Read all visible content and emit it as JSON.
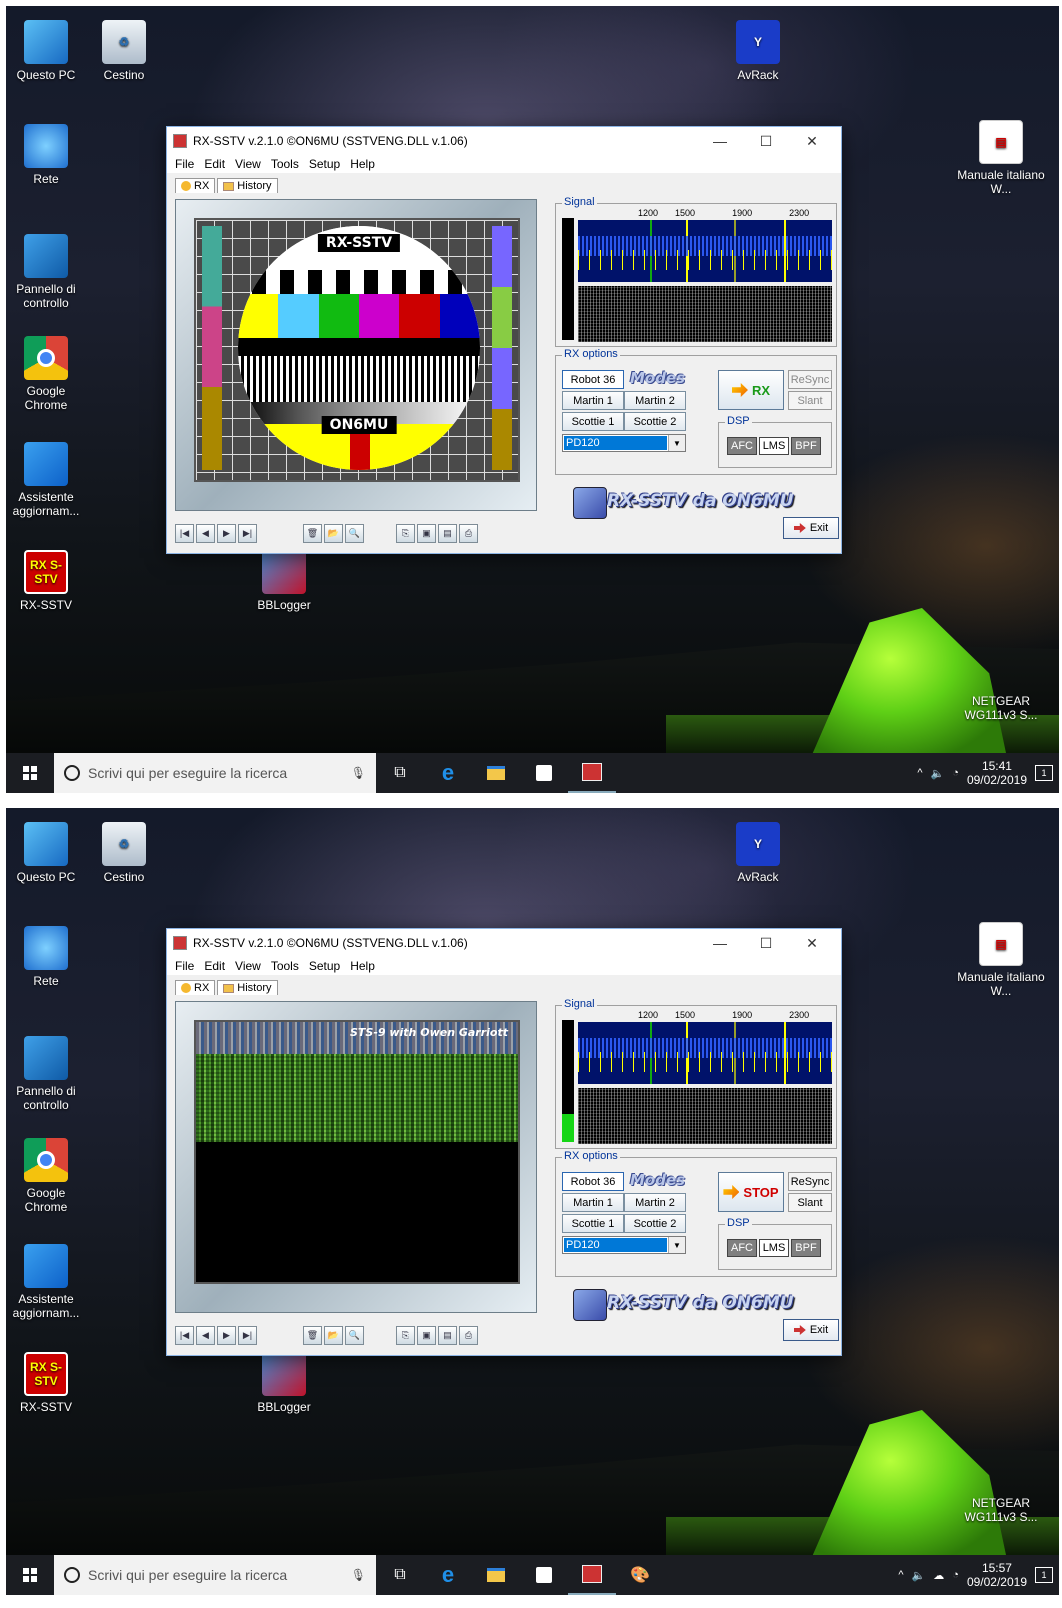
{
  "desktop": {
    "icons_left": [
      {
        "label": "Questo PC",
        "icon": "computer-icon"
      },
      {
        "label": "Cestino",
        "icon": "recycle-bin-icon"
      },
      {
        "label": "Rete",
        "icon": "network-icon"
      },
      {
        "label": "Pannello di controllo",
        "icon": "control-panel-icon"
      },
      {
        "label": "Google Chrome",
        "icon": "chrome-icon"
      },
      {
        "label": "Assistente aggiornam...",
        "icon": "windows-update-icon"
      },
      {
        "label": "RX-SSTV",
        "icon": "rx-sstv-icon"
      },
      {
        "label": "BBLogger",
        "icon": "bblogger-icon"
      }
    ],
    "icons_right": [
      {
        "label": "AvRack",
        "icon": "avrack-icon"
      },
      {
        "label": "Manuale italiano W...",
        "icon": "pdf-icon"
      },
      {
        "label": "NETGEAR WG111v3 S...",
        "icon": "wireless-adapter-icon"
      }
    ],
    "rx_icon_text": "RX S-STV"
  },
  "window": {
    "title": "RX-SSTV v.2.1.0 ©ON6MU (SSTVENG.DLL v.1.06)",
    "menu": [
      "File",
      "Edit",
      "View",
      "Tools",
      "Setup",
      "Help"
    ],
    "tabs": [
      "RX",
      "History"
    ],
    "signal_label": "Signal",
    "freqs": [
      "1200",
      "1500",
      "1900",
      "2300"
    ],
    "rx_options_label": "RX options",
    "modes_logo": "Modes",
    "mode_buttons": [
      "Robot 36",
      "Martin 1",
      "Martin 2",
      "Scottie 1",
      "Scottie 2"
    ],
    "mode_selected": "PD120",
    "resync": "ReSync",
    "slant": "Slant",
    "dsp_label": "DSP",
    "dsp_buttons": [
      "AFC",
      "LMS",
      "BPF"
    ],
    "brand": "RX-SSTV da ON6MU",
    "exit": "Exit",
    "testcard_top": "RX-SSTV",
    "testcard_bottom": "ON6MU"
  },
  "screen1": {
    "rx_button": "RX",
    "time": "15:41",
    "date": "09/02/2019"
  },
  "screen2": {
    "rx_button": "STOP",
    "image_caption": "STS-9 with Owen Garriott",
    "time": "15:57",
    "date": "09/02/2019"
  },
  "taskbar": {
    "search_placeholder": "Scrivi qui per eseguire la ricerca",
    "notif_count": "1"
  },
  "colors": {
    "desktop_bg": "#141a2a",
    "waterfall_bg": "#00126a",
    "tent": "#7fe020",
    "rx_green": "#1a9a1a",
    "stop_red": "#d00000"
  },
  "level_meter": {
    "screen1": 0,
    "screen2": 0.23
  }
}
